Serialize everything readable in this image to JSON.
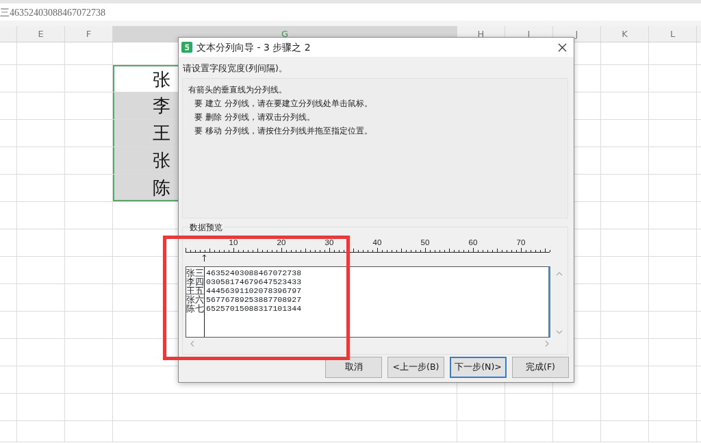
{
  "formula_bar": {
    "text": "三46352403088467072738"
  },
  "columns": [
    {
      "label": "E",
      "selected": false
    },
    {
      "label": "F",
      "selected": false
    },
    {
      "label": "G",
      "selected": true
    },
    {
      "label": "H",
      "selected": false
    },
    {
      "label": "I",
      "selected": false
    },
    {
      "label": "J",
      "selected": false
    },
    {
      "label": "K",
      "selected": false
    },
    {
      "label": "L",
      "selected": false
    }
  ],
  "cells": [
    {
      "text": "张",
      "active": true
    },
    {
      "text": "李",
      "active": false
    },
    {
      "text": "王",
      "active": false
    },
    {
      "text": "张",
      "active": false
    },
    {
      "text": "陈",
      "active": false
    }
  ],
  "dialog": {
    "title": "文本分列向导 - 3 步骤之 2",
    "prompt": "请设置字段宽度(列间隔)。",
    "instructions": [
      "有箭头的垂直线为分列线。",
      "要 建立 分列线，请在要建立分列线处单击鼠标。",
      "要 删除 分列线，请双击分列线。",
      "要 移动 分列线，请按住分列线并拖至指定位置。"
    ],
    "preview_label": "数据预览",
    "ruler_labels": [
      "10",
      "20",
      "30",
      "40",
      "50",
      "60",
      "70"
    ],
    "preview_rows": [
      {
        "name": "张三",
        "value": "46352403088467072738"
      },
      {
        "name": "李四",
        "value": "03058174679647523433"
      },
      {
        "name": "王五",
        "value": "44456391102078396797"
      },
      {
        "name": "张六",
        "value": "56776789253887708927"
      },
      {
        "name": "陈七",
        "value": "65257015088317101344"
      }
    ],
    "buttons": [
      {
        "label": "取消",
        "selected": false
      },
      {
        "label": "<上一步(B)",
        "selected": false
      },
      {
        "label": "下一步(N)>",
        "selected": true
      },
      {
        "label": "完成(F)",
        "selected": false
      }
    ]
  }
}
